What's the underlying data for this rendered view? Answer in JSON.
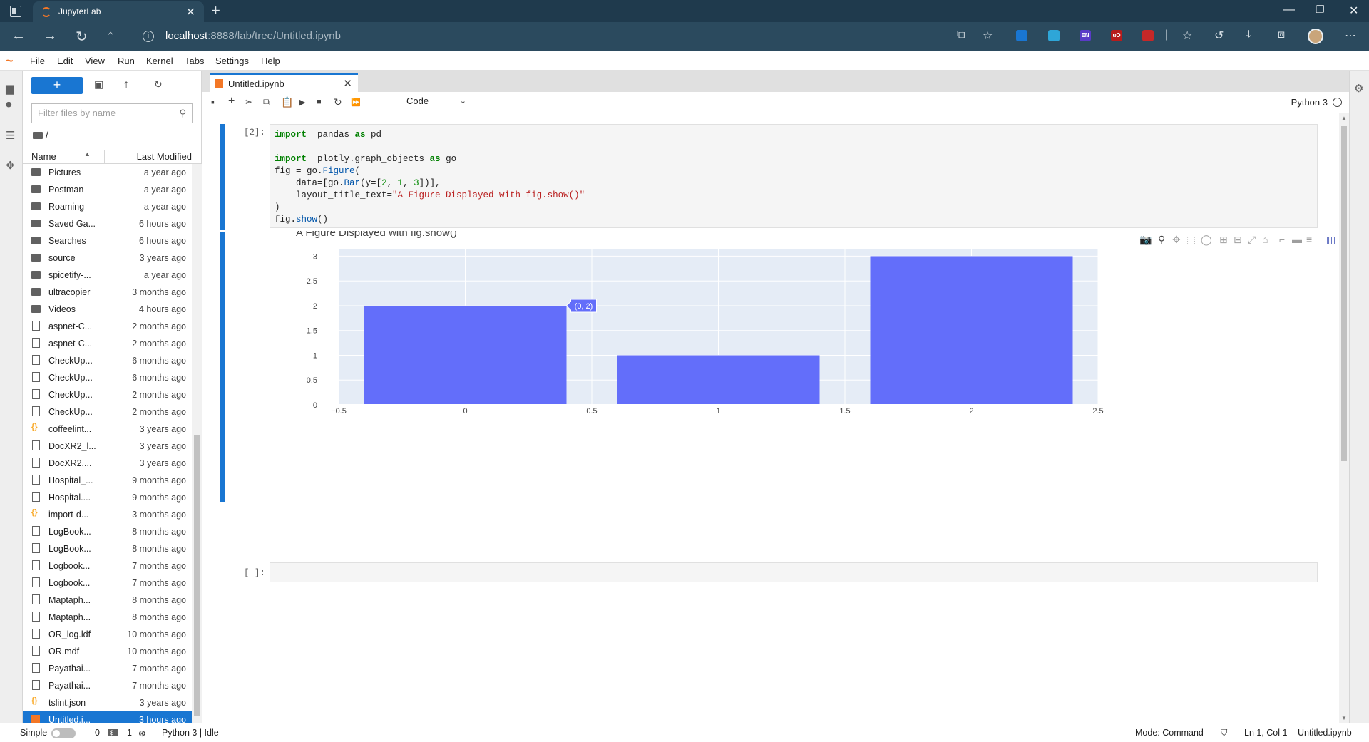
{
  "browser": {
    "tab_title": "JupyterLab",
    "url_host": "localhost",
    "url_rest": ":8888/lab/tree/Untitled.ipynb",
    "extensions": [
      {
        "icon": "reading-list-icon",
        "color": "#1976d2",
        "text": ""
      },
      {
        "icon": "telegram-icon",
        "color": "#2ea6d8",
        "text": ""
      },
      {
        "icon": "translate-icon",
        "color": "#5a3bc7",
        "text": "EN"
      },
      {
        "icon": "ublock-icon",
        "color": "#b71c1c",
        "text": "uO"
      },
      {
        "icon": "shield-ext-icon",
        "color": "#c62828",
        "text": ""
      }
    ]
  },
  "menu": [
    "File",
    "Edit",
    "View",
    "Run",
    "Kernel",
    "Tabs",
    "Settings",
    "Help"
  ],
  "filebrowser": {
    "search_placeholder": "Filter files by name",
    "breadcrumb": "/",
    "col_name": "Name",
    "col_modified": "Last Modified",
    "files": [
      {
        "name": "Pictures",
        "modified": "a year ago",
        "type": "folder"
      },
      {
        "name": "Postman",
        "modified": "a year ago",
        "type": "folder"
      },
      {
        "name": "Roaming",
        "modified": "a year ago",
        "type": "folder"
      },
      {
        "name": "Saved Ga...",
        "modified": "6 hours ago",
        "type": "folder"
      },
      {
        "name": "Searches",
        "modified": "6 hours ago",
        "type": "folder"
      },
      {
        "name": "source",
        "modified": "3 years ago",
        "type": "folder"
      },
      {
        "name": "spicetify-...",
        "modified": "a year ago",
        "type": "folder"
      },
      {
        "name": "ultracopier",
        "modified": "3 months ago",
        "type": "folder"
      },
      {
        "name": "Videos",
        "modified": "4 hours ago",
        "type": "folder"
      },
      {
        "name": "aspnet-C...",
        "modified": "2 months ago",
        "type": "file"
      },
      {
        "name": "aspnet-C...",
        "modified": "2 months ago",
        "type": "file"
      },
      {
        "name": "CheckUp...",
        "modified": "6 months ago",
        "type": "file"
      },
      {
        "name": "CheckUp...",
        "modified": "6 months ago",
        "type": "file"
      },
      {
        "name": "CheckUp...",
        "modified": "2 months ago",
        "type": "file"
      },
      {
        "name": "CheckUp...",
        "modified": "2 months ago",
        "type": "file"
      },
      {
        "name": "coffeelint...",
        "modified": "3 years ago",
        "type": "json"
      },
      {
        "name": "DocXR2_l...",
        "modified": "3 years ago",
        "type": "file"
      },
      {
        "name": "DocXR2....",
        "modified": "3 years ago",
        "type": "file"
      },
      {
        "name": "Hospital_...",
        "modified": "9 months ago",
        "type": "file"
      },
      {
        "name": "Hospital....",
        "modified": "9 months ago",
        "type": "file"
      },
      {
        "name": "import-d...",
        "modified": "3 months ago",
        "type": "json"
      },
      {
        "name": "LogBook...",
        "modified": "8 months ago",
        "type": "file"
      },
      {
        "name": "LogBook...",
        "modified": "8 months ago",
        "type": "file"
      },
      {
        "name": "Logbook...",
        "modified": "7 months ago",
        "type": "file"
      },
      {
        "name": "Logbook...",
        "modified": "7 months ago",
        "type": "file"
      },
      {
        "name": "Maptaph...",
        "modified": "8 months ago",
        "type": "file"
      },
      {
        "name": "Maptaph...",
        "modified": "8 months ago",
        "type": "file"
      },
      {
        "name": "OR_log.ldf",
        "modified": "10 months ago",
        "type": "file"
      },
      {
        "name": "OR.mdf",
        "modified": "10 months ago",
        "type": "file"
      },
      {
        "name": "Payathai...",
        "modified": "7 months ago",
        "type": "file"
      },
      {
        "name": "Payathai...",
        "modified": "7 months ago",
        "type": "file"
      },
      {
        "name": "tslint.json",
        "modified": "3 years ago",
        "type": "json"
      },
      {
        "name": "Untitled.i...",
        "modified": "3 hours ago",
        "type": "notebook",
        "selected": true
      }
    ]
  },
  "notebook": {
    "tab_title": "Untitled.ipynb",
    "cell_type": "Code",
    "kernel": "Python 3",
    "cell1_prompt": "[2]:",
    "cell2_prompt": "[ ]:",
    "code_lines": [
      [
        [
          "kw",
          "import"
        ],
        [
          "",
          "  pandas "
        ],
        [
          "kw",
          "as"
        ],
        [
          "",
          " pd"
        ]
      ],
      [],
      [
        [
          "kw",
          "import"
        ],
        [
          "",
          "  plotly.graph_objects "
        ],
        [
          "kw",
          "as"
        ],
        [
          "",
          " go"
        ]
      ],
      [
        [
          "",
          "fig = go."
        ],
        [
          "fn",
          "Figure"
        ],
        [
          "",
          "("
        ]
      ],
      [
        [
          "",
          "    data=[go."
        ],
        [
          "fn",
          "Bar"
        ],
        [
          "",
          "(y=["
        ],
        [
          "num",
          "2"
        ],
        [
          "",
          ", "
        ],
        [
          "num",
          "1"
        ],
        [
          "",
          ", "
        ],
        [
          "num",
          "3"
        ],
        [
          "",
          "])],"
        ]
      ],
      [
        [
          "",
          "    layout_title_text="
        ],
        [
          "str",
          "\"A Figure Displayed with fig.show()\""
        ]
      ],
      [
        [
          "",
          ")"
        ]
      ],
      [
        [
          "",
          "fig."
        ],
        [
          "fn",
          "show"
        ],
        [
          "",
          "()"
        ]
      ]
    ]
  },
  "chart_data": {
    "type": "bar",
    "title": "A Figure Displayed with fig.show()",
    "x": [
      0,
      1,
      2
    ],
    "values": [
      2,
      1,
      3
    ],
    "bar_color": "#636efa",
    "plot_bg": "#e5ecf6",
    "xlim": [
      -0.5,
      2.5
    ],
    "ylim": [
      0,
      3.15
    ],
    "x_ticks": [
      "−0.5",
      "0",
      "0.5",
      "1",
      "1.5",
      "2",
      "2.5"
    ],
    "x_tick_values": [
      -0.5,
      0,
      0.5,
      1,
      1.5,
      2,
      2.5
    ],
    "y_ticks": [
      "0",
      "0.5",
      "1",
      "1.5",
      "2",
      "2.5",
      "3"
    ],
    "y_tick_values": [
      0,
      0.5,
      1,
      1.5,
      2,
      2.5,
      3
    ],
    "hover_label": "(0, 2)",
    "hover_point": {
      "x": 0,
      "y": 2
    }
  },
  "status": {
    "mode_label": "Simple",
    "terminals": "0",
    "kernels": "1",
    "kernel_status": "Python 3 | Idle",
    "mode": "Mode: Command",
    "cursor": "Ln 1, Col 1",
    "file": "Untitled.ipynb"
  }
}
